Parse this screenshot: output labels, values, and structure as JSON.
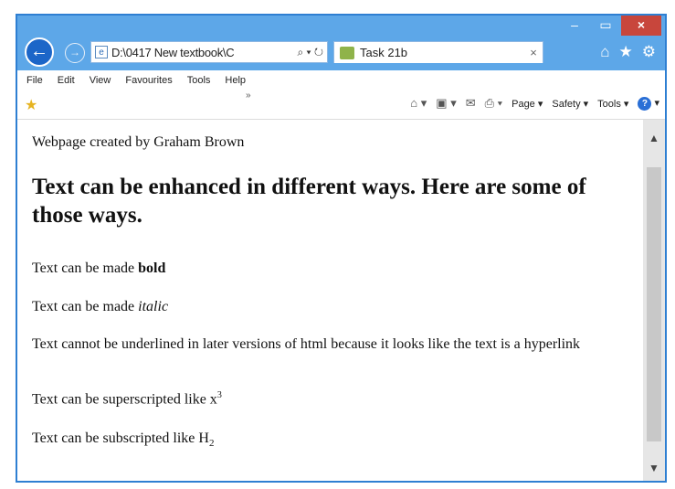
{
  "browser": {
    "address": "D:\\0417 New textbook\\C",
    "address_tools": "⌕ ▾ ↻",
    "tab_title": "Task 21b",
    "tab_close": "×",
    "menu": [
      "File",
      "Edit",
      "View",
      "Favourites",
      "Tools",
      "Help"
    ],
    "commands": {
      "page": "Page ▾",
      "safety": "Safety ▾",
      "tools": "Tools ▾"
    },
    "accent": "#5da7e8"
  },
  "page": {
    "creator": "Webpage created by Graham Brown",
    "heading": "Text can be enhanced in different ways. Here are some of those ways.",
    "bold_prefix": "Text can be made ",
    "bold_word": "bold",
    "italic_prefix": "Text can be made ",
    "italic_word": "italic",
    "underline_note": "Text cannot be underlined in later versions of html because it looks like the text is a hyperlink",
    "super_prefix": "Text can be superscripted like x",
    "super_value": "3",
    "sub_prefix": "Text can be subscripted like H",
    "sub_value": "2"
  }
}
